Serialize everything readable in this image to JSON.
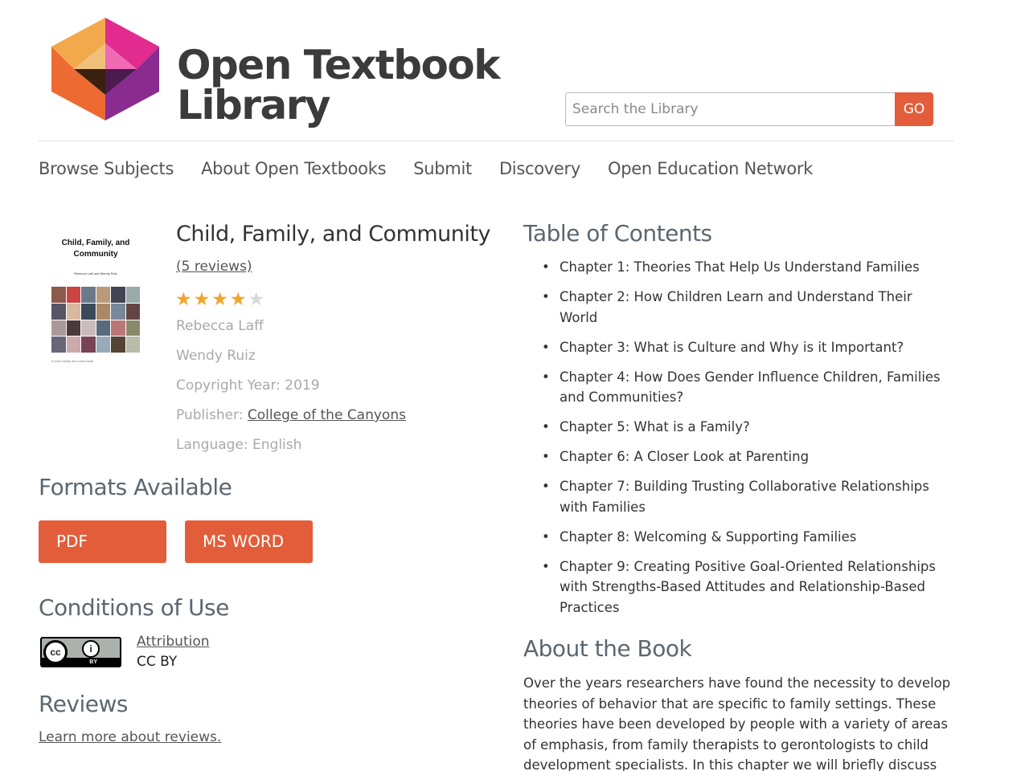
{
  "header": {
    "logo_line1": "Open Textbook",
    "logo_line2": "Library",
    "search_placeholder": "Search the Library",
    "go_label": "GO"
  },
  "nav": {
    "items": [
      "Browse Subjects",
      "About Open Textbooks",
      "Submit",
      "Discovery",
      "Open Education Network"
    ]
  },
  "book": {
    "cover_title": "Child, Family, and Community",
    "cover_authors": "Rebecca Laff and Wendy Ruiz",
    "cover_footer": "In their family and community",
    "title": "Child, Family, and Community",
    "reviews_link": "(5 reviews)",
    "rating": 4,
    "rating_max": 5,
    "author1": "Rebecca Laff",
    "author2": "Wendy Ruiz",
    "copyright": "Copyright Year: 2019",
    "publisher_label": "Publisher: ",
    "publisher_name": "College of the Canyons",
    "language": "Language: English"
  },
  "formats": {
    "heading": "Formats Available",
    "pdf": "PDF",
    "msword": "MS WORD"
  },
  "conditions": {
    "heading": "Conditions of Use",
    "attribution_link": "Attribution",
    "license": "CC BY",
    "badge_cc": "cc",
    "badge_by": "BY"
  },
  "reviews": {
    "heading": "Reviews",
    "learn_more": "Learn more about reviews."
  },
  "toc": {
    "heading": "Table of Contents",
    "chapters": [
      "Chapter 1: Theories That Help Us Understand Families",
      "Chapter 2: How Children Learn and Understand Their World",
      "Chapter 3: What is Culture and Why is it Important?",
      "Chapter 4: How Does Gender Influence Children, Families and Communities?",
      "Chapter 5: What is a Family?",
      "Chapter 6: A Closer Look at Parenting",
      "Chapter 7: Building Trusting Collaborative Relationships with Families",
      "Chapter 8: Welcoming & Supporting Families",
      "Chapter 9: Creating Positive Goal-Oriented Relationships with Strengths-Based Attitudes and Relationship-Based Practices"
    ]
  },
  "about": {
    "heading": "About the Book",
    "text": "Over the years researchers have found the necessity to develop theories of behavior that are specific to family settings. These theories have been developed by people with a variety of areas of emphasis, from family therapists to gerontologists to child development specialists. In this chapter we will briefly discuss six"
  },
  "colors": {
    "accent": "#e35d3a",
    "star": "#f3a52a",
    "heading": "#5b6770"
  }
}
